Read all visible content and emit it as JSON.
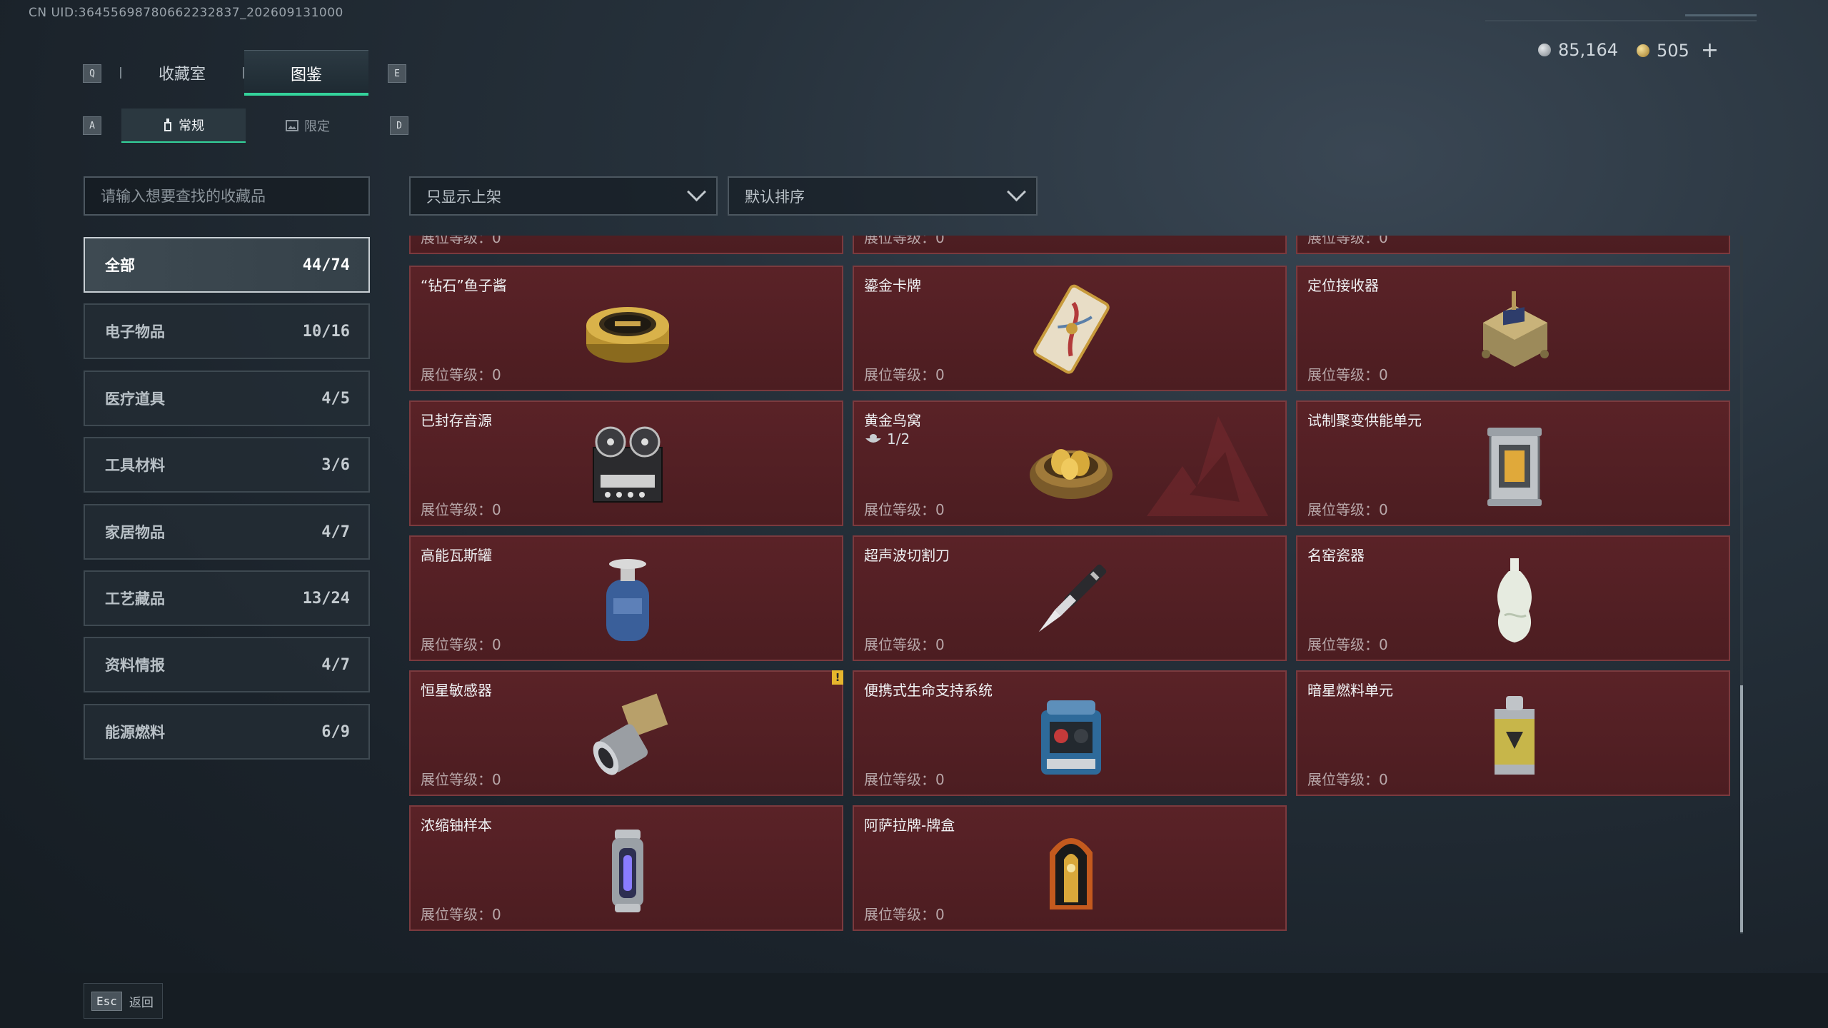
{
  "uid": "CN UID:3645569878066223283​7_202609131000",
  "currency": {
    "silver": "85,164",
    "gold": "505"
  },
  "keys": {
    "prev_tab": "Q",
    "next_tab": "E",
    "prev_sub": "A",
    "next_sub": "D"
  },
  "tabs": [
    "收藏室",
    "图鉴"
  ],
  "subtabs": [
    "常规",
    "限定"
  ],
  "search": {
    "placeholder": "请输入想要查找的收藏品"
  },
  "filters": {
    "shelf": "只显示上架",
    "sort": "默认排序"
  },
  "categories": [
    {
      "label": "全部",
      "count": "44/74"
    },
    {
      "label": "电子物品",
      "count": "10/16"
    },
    {
      "label": "医疗道具",
      "count": "4/5"
    },
    {
      "label": "工具材料",
      "count": "3/6"
    },
    {
      "label": "家居物品",
      "count": "4/7"
    },
    {
      "label": "工艺藏品",
      "count": "13/24"
    },
    {
      "label": "资料情报",
      "count": "4/7"
    },
    {
      "label": "能源燃料",
      "count": "6/9"
    }
  ],
  "level_label": "展位等级：0",
  "items": [
    {
      "name": "",
      "icon": "partial-item-icon"
    },
    {
      "name": "",
      "icon": "partial-item-icon"
    },
    {
      "name": "",
      "icon": "partial-item-icon"
    },
    {
      "name": "“钻石”鱼子酱",
      "icon": "caviar-tin-icon"
    },
    {
      "name": "鎏金卡牌",
      "icon": "gilded-card-icon"
    },
    {
      "name": "定位接收器",
      "icon": "locator-receiver-icon"
    },
    {
      "name": "已封存音源",
      "icon": "reel-recorder-icon"
    },
    {
      "name": "黄金鸟窝",
      "icon": "golden-nest-icon",
      "sub": "1/2"
    },
    {
      "name": "试制聚变供能单元",
      "icon": "fusion-unit-icon"
    },
    {
      "name": "高能瓦斯罐",
      "icon": "gas-canister-icon"
    },
    {
      "name": "超声波切割刀",
      "icon": "ultrasonic-knife-icon"
    },
    {
      "name": "名窑瓷器",
      "icon": "porcelain-vase-icon"
    },
    {
      "name": "恒星敏感器",
      "icon": "star-sensor-icon",
      "warn": "!"
    },
    {
      "name": "便携式生命支持系统",
      "icon": "life-support-icon"
    },
    {
      "name": "暗星燃料单元",
      "icon": "fuel-canister-icon"
    },
    {
      "name": "浓缩铀样本",
      "icon": "uranium-sample-icon"
    },
    {
      "name": "阿萨拉牌-牌盒",
      "icon": "card-box-icon"
    }
  ],
  "footer": {
    "key": "Esc",
    "label": "返回"
  },
  "colors": {
    "accent": "#34d39b",
    "card": "#5a2227",
    "warn": "#e6b52d"
  }
}
